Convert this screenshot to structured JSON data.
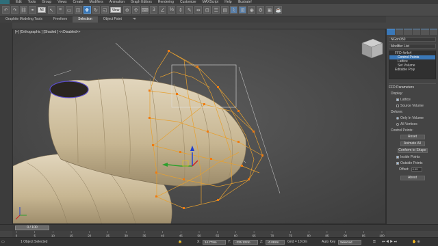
{
  "menu": [
    "Edit",
    "Tools",
    "Group",
    "Views",
    "Create",
    "Modifiers",
    "Animation",
    "Graph Editors",
    "Rendering",
    "Customize",
    "MAXScript",
    "Help",
    "Illustrate!"
  ],
  "toolbar": {
    "selection_filter": "All",
    "ref_coord": "View",
    "undo_icon": "undo-icon",
    "redo_icon": "redo-icon",
    "select_icon": "select-arrow-icon",
    "move_icon": "move-icon",
    "rotate_icon": "rotate-icon",
    "scale_icon": "scale-icon"
  },
  "ribbon": {
    "tabs": [
      "Graphite Modeling Tools",
      "Freeform",
      "Selection",
      "Object Paint"
    ],
    "active": "Selection"
  },
  "viewport": {
    "label": "[+] [Orthographic ] [Shaded ] <<Disabled>>"
  },
  "panel": {
    "object_name": "NGon050",
    "modifier_list": "Modifier List",
    "stack": [
      {
        "label": "FFD 4x4x4",
        "level": 0,
        "selected": false
      },
      {
        "label": "Control Points",
        "level": 1,
        "selected": true
      },
      {
        "label": "Lattice",
        "level": 1,
        "selected": false
      },
      {
        "label": "Set Volume",
        "level": 1,
        "selected": false
      },
      {
        "label": "Editable Poly",
        "level": 0,
        "selected": false
      }
    ],
    "rollout_title": "FFD Parameters",
    "display_label": "Display:",
    "display_lattice": "Lattice",
    "display_source": "Source Volume",
    "deform_label": "Deform:",
    "deform_inside": "Only In Volume",
    "deform_all": "All Vertices",
    "control_points_label": "Control Points:",
    "reset_btn": "Reset",
    "animate_all_btn": "Animate All",
    "conform_btn": "Conform to Shape",
    "inside_points": "Inside Points",
    "outside_points": "Outside Points",
    "offset_label": "Offset:",
    "offset_value": "0.05",
    "about_btn": "About"
  },
  "timeline": {
    "frame": "0 / 100",
    "ticks": [
      "0",
      "5",
      "10",
      "15",
      "20",
      "25",
      "30",
      "35",
      "40",
      "45",
      "50",
      "55",
      "60",
      "65",
      "70",
      "75",
      "80",
      "85",
      "90",
      "95",
      "100"
    ]
  },
  "status": {
    "selection": "1 Object Selected",
    "x_label": "X:",
    "x_value": "14.779m",
    "y_label": "Y:",
    "y_value": "-225.122m",
    "z_label": "Z:",
    "z_value": "-0.092m",
    "grid": "Grid = 10.0m",
    "auto_key": "Auto Key",
    "selected_mode": "Selected",
    "set_key": "Set Key"
  },
  "colors": {
    "accent": "#3a78b8",
    "lattice": "#e6a030",
    "lattice_points": "#f07a10",
    "shell": "#c9b998"
  }
}
